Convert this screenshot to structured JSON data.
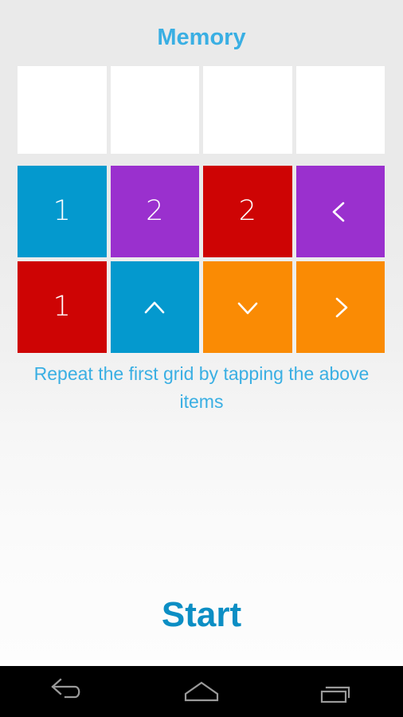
{
  "app": {
    "title": "Memory",
    "background_color": "#eaeaea",
    "accent_color": "#3aafe3"
  },
  "target_grid": {
    "label": "target-sequence-grid",
    "columns": 4,
    "rows": 1,
    "cells": [
      {
        "id": "t1",
        "value": "",
        "type": "empty",
        "color": "#ffffff"
      },
      {
        "id": "t2",
        "value": "",
        "type": "empty",
        "color": "#ffffff"
      },
      {
        "id": "t3",
        "value": "",
        "type": "empty",
        "color": "#ffffff"
      },
      {
        "id": "t4",
        "value": "",
        "type": "empty",
        "color": "#ffffff"
      }
    ]
  },
  "input_grid": {
    "label": "input-tile-grid",
    "columns": 4,
    "rows": 2,
    "cells": [
      {
        "id": "i1",
        "value": "1",
        "type": "number",
        "color": "#0499ce",
        "icon": ""
      },
      {
        "id": "i2",
        "value": "2",
        "type": "number",
        "color": "#9a30ce",
        "icon": ""
      },
      {
        "id": "i3",
        "value": "2",
        "type": "number",
        "color": "#ce0404",
        "icon": ""
      },
      {
        "id": "i4",
        "value": "",
        "type": "icon",
        "color": "#9a30ce",
        "icon": "chevron-left-icon"
      },
      {
        "id": "i5",
        "value": "1",
        "type": "number",
        "color": "#ce0404",
        "icon": ""
      },
      {
        "id": "i6",
        "value": "",
        "type": "icon",
        "color": "#0499ce",
        "icon": "chevron-up-icon"
      },
      {
        "id": "i7",
        "value": "",
        "type": "icon",
        "color": "#fa8b04",
        "icon": "chevron-down-icon"
      },
      {
        "id": "i8",
        "value": "",
        "type": "icon",
        "color": "#fa8b04",
        "icon": "chevron-right-icon"
      }
    ]
  },
  "instruction": {
    "text": "Repeat the first grid by tapping the above items",
    "color": "#3aafe3"
  },
  "start_button": {
    "label": "Start",
    "color": "#0c8ec4"
  },
  "navbar": {
    "background": "#000000",
    "buttons": [
      {
        "name": "back-icon",
        "label": "Back"
      },
      {
        "name": "home-icon",
        "label": "Home"
      },
      {
        "name": "recents-icon",
        "label": "Recent apps"
      }
    ]
  }
}
